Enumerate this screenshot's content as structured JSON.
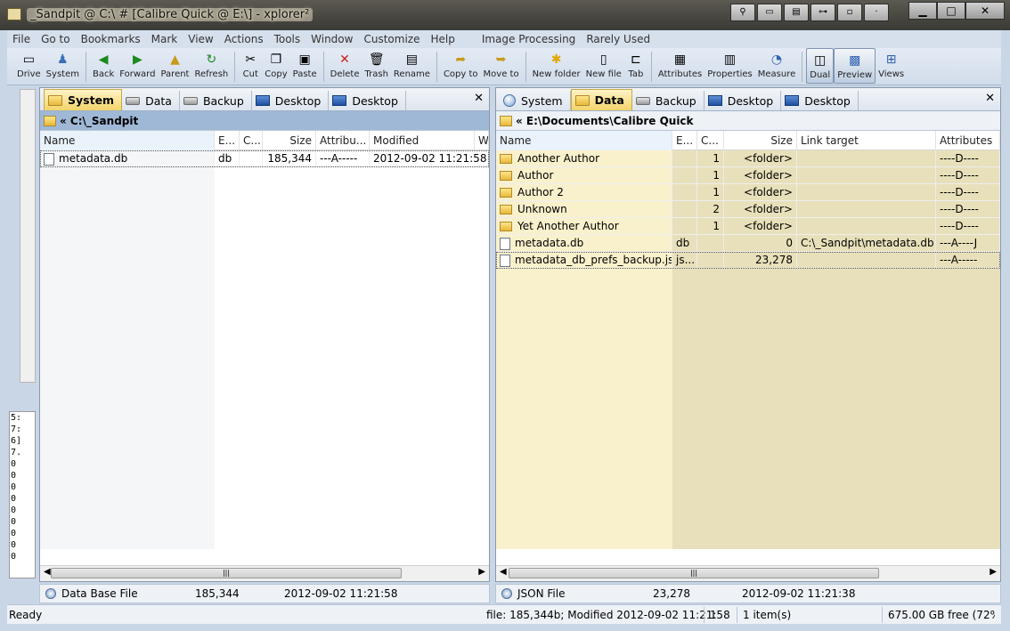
{
  "window": {
    "title": "_Sandpit @ C:\\ # [Calibre Quick @ E:\\] - xplorer²",
    "buttons": {
      "minimize": "▁",
      "maximize": "□",
      "close": "✕"
    }
  },
  "menu": [
    "File",
    "Go to",
    "Bookmarks",
    "Mark",
    "View",
    "Actions",
    "Tools",
    "Window",
    "Customize",
    "Help",
    "Image Processing",
    "Rarely Used"
  ],
  "toolbar": {
    "drive": "Drive",
    "system": "System",
    "back": "Back",
    "forward": "Forward",
    "parent": "Parent",
    "refresh": "Refresh",
    "cut": "Cut",
    "copy": "Copy",
    "paste": "Paste",
    "delete": "Delete",
    "trash": "Trash",
    "rename": "Rename",
    "copy_to": "Copy to",
    "move_to": "Move to",
    "new_folder": "New folder",
    "new_file": "New file",
    "tab": "Tab",
    "attributes": "Attributes",
    "properties": "Properties",
    "measure": "Measure",
    "dual": "Dual",
    "preview": "Preview",
    "views": "Views"
  },
  "left_pane": {
    "tabs": [
      "System",
      "Data",
      "Backup",
      "Desktop",
      "Desktop"
    ],
    "path": "« C:\\_Sandpit",
    "columns": [
      "Name",
      "E...",
      "C...",
      "Size",
      "Attribu...",
      "Modified",
      "Wi"
    ],
    "rows": [
      {
        "name": "metadata.db",
        "ext": "db",
        "c": "",
        "size": "185,344",
        "attr": "---A-----",
        "modified": "2012-09-02 11:21:58"
      }
    ],
    "info": {
      "type": "Data Base File",
      "size": "185,344",
      "date": "2012-09-02 11:21:58"
    }
  },
  "right_pane": {
    "tabs": [
      "System",
      "Data",
      "Backup",
      "Desktop",
      "Desktop"
    ],
    "path": "« E:\\Documents\\Calibre Quick",
    "columns": [
      "Name",
      "E...",
      "C...",
      "Size",
      "Link target",
      "Attributes"
    ],
    "rows": [
      {
        "name": "Another Author",
        "ext": "",
        "c": "1",
        "size": "<folder>",
        "link": "",
        "attr": "----D----"
      },
      {
        "name": "Author",
        "ext": "",
        "c": "1",
        "size": "<folder>",
        "link": "",
        "attr": "----D----"
      },
      {
        "name": "Author 2",
        "ext": "",
        "c": "1",
        "size": "<folder>",
        "link": "",
        "attr": "----D----"
      },
      {
        "name": "Unknown",
        "ext": "",
        "c": "2",
        "size": "<folder>",
        "link": "",
        "attr": "----D----"
      },
      {
        "name": "Yet Another Author",
        "ext": "",
        "c": "1",
        "size": "<folder>",
        "link": "",
        "attr": "----D----"
      },
      {
        "name": "metadata.db",
        "ext": "db",
        "c": "",
        "size": "0",
        "link": "C:\\_Sandpit\\metadata.db",
        "attr": "---A----J"
      },
      {
        "name": "metadata_db_prefs_backup.json",
        "ext": "js...",
        "c": "",
        "size": "23,278",
        "link": "",
        "attr": "---A-----"
      }
    ],
    "info": {
      "type": "JSON File",
      "size": "23,278",
      "date": "2012-09-02 11:21:38"
    }
  },
  "left_numbers": [
    "5:",
    "7:",
    "6]",
    "7.",
    "0",
    "0",
    "0",
    "0",
    "0",
    "0",
    "0",
    "0",
    "0"
  ],
  "status": {
    "ready": "Ready",
    "file": "file: 185,344b; Modified 2012-09-02 11:21:58",
    "count": "1",
    "items": "1 item(s)",
    "free": "675.00 GB free (72%"
  }
}
